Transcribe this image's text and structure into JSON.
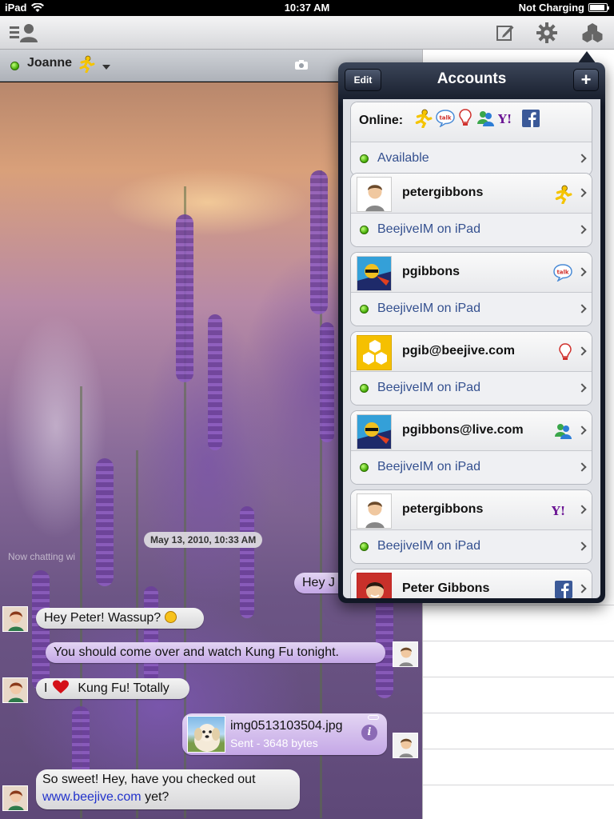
{
  "status_bar": {
    "device": "iPad",
    "time": "10:37 AM",
    "battery_text": "Not Charging",
    "battery_level": 0.9
  },
  "toolbar": {
    "left_icon": "contacts-list-icon",
    "icons": [
      "compose-icon",
      "gear-icon",
      "accounts-icon"
    ]
  },
  "chat": {
    "contact_name": "Joanne",
    "contact_service_icon": "aim-running-man-icon",
    "date_stamp": "May 13, 2010, 10:33 AM",
    "now_chatting": "Now chatting wi",
    "messages": [
      {
        "from": "me",
        "text": "Hey J"
      },
      {
        "from": "them",
        "text": "Hey Peter! Wassup?"
      },
      {
        "from": "me",
        "text": "You should come over and watch Kung Fu tonight."
      },
      {
        "from": "them",
        "text_pre": "I",
        "text_post": "Kung Fu! Totally"
      },
      {
        "from": "me",
        "file_name": "img0513103504.jpg",
        "file_status": "Sent - 3648 bytes"
      },
      {
        "from": "them",
        "line1": "So sweet! Hey, have you checked out",
        "link": "www.beejive.com",
        "line2_post": "yet?"
      }
    ]
  },
  "accounts": {
    "title": "Accounts",
    "edit_label": "Edit",
    "add_label": "+",
    "online_label": "Online:",
    "online_status": "Available",
    "service_icons": [
      "aim-icon",
      "gtalk-icon",
      "bulb-icon",
      "msn-icon",
      "yahoo-icon",
      "facebook-icon"
    ],
    "list": [
      {
        "name": "petergibbons",
        "service": "aim-icon",
        "status": "BeejiveIM on iPad"
      },
      {
        "name": "pgibbons",
        "service": "gtalk-icon",
        "status": "BeejiveIM on iPad"
      },
      {
        "name": "pgib@beejive.com",
        "service": "bulb-icon",
        "status": "BeejiveIM on iPad"
      },
      {
        "name": "pgibbons@live.com",
        "service": "msn-icon",
        "status": "BeejiveIM on iPad"
      },
      {
        "name": "petergibbons",
        "service": "yahoo-icon",
        "status": "BeejiveIM on iPad"
      },
      {
        "name": "Peter Gibbons",
        "service": "facebook-icon",
        "status": ""
      }
    ]
  },
  "colors": {
    "online_green": "#3fa800",
    "link_blue": "#2233cc",
    "status_blue": "#34508f",
    "popover_dark": "#121826"
  }
}
